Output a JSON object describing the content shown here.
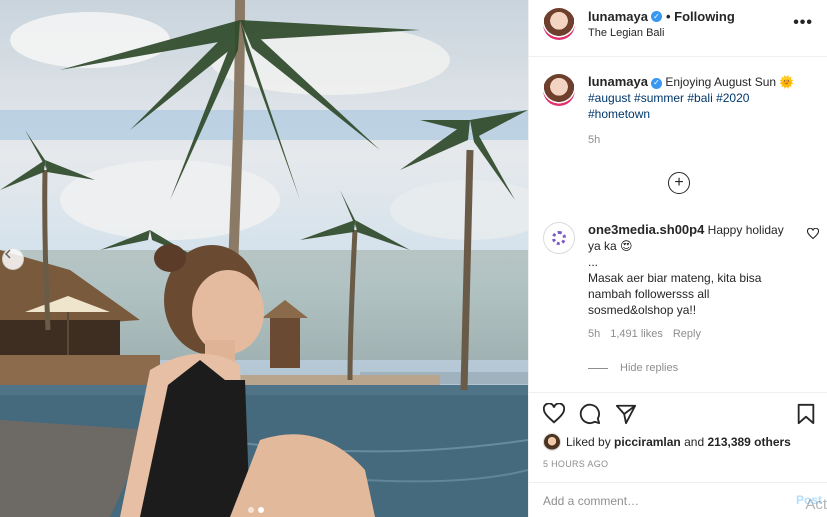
{
  "post": {
    "username": "lunamaya",
    "following_label": "• Following",
    "location": "The Legian Bali",
    "more_label": "•••"
  },
  "caption": {
    "username": "lunamaya",
    "text": "Enjoying August Sun",
    "hashtags": "#august #summer #bali #2020 #hometown",
    "time": "5h"
  },
  "load_more": {
    "icon": "plus-circle-icon",
    "label": "+"
  },
  "comment": {
    "username": "one3media.sh00p4",
    "text_line1": "Happy holiday ya ka 😍",
    "text_line2": "...",
    "text_line3": "Masak aer biar mateng, kita bisa nambah followersss all sosmed&olshop ya!!",
    "time": "5h",
    "likes": "1,491 likes",
    "reply_label": "Reply",
    "hide_replies": "Hide replies"
  },
  "actions": {
    "liked_by_prefix": "Liked by",
    "liked_by_user": "picciramlan",
    "liked_by_suffix": "and",
    "liked_by_count": "213,389 others",
    "timestamp": "5 HOURS AGO"
  },
  "add_comment": {
    "placeholder": "Add a comment…",
    "post_label": "Post"
  },
  "overlay": {
    "watermark": "Act"
  },
  "colors": {
    "link": "#00376b",
    "verified": "#3897f0",
    "muted": "#8e8e8e",
    "post_disabled": "#b2dffc"
  }
}
